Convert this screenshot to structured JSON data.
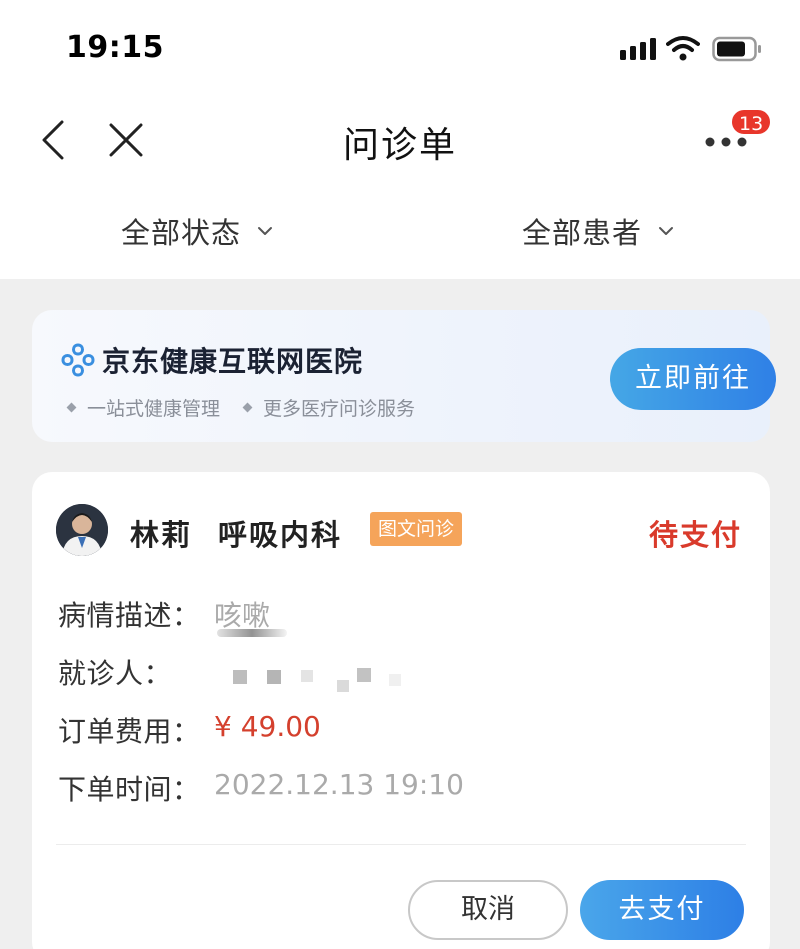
{
  "status_bar": {
    "time": "19:15"
  },
  "nav": {
    "title": "问诊单",
    "badge": "13"
  },
  "filters": {
    "status": "全部状态",
    "patient": "全部患者"
  },
  "banner": {
    "title": "京东健康互联网医院",
    "sub1": "一站式健康管理",
    "sub2": "更多医疗问诊服务",
    "button": "立即前往"
  },
  "order": {
    "doctor_name": "林莉",
    "department": "呼吸内科",
    "tag": "图文问诊",
    "status": "待支付",
    "rows": [
      {
        "label": "病情描述：",
        "value": "咳嗽"
      },
      {
        "label": "就诊人：",
        "value": ""
      },
      {
        "label": "订单费用：",
        "value": "¥ 49.00"
      },
      {
        "label": "下单时间：",
        "value": "2022.12.13 19:10"
      }
    ],
    "cancel_label": "取消",
    "pay_label": "去支付"
  },
  "colors": {
    "accent_blue": "#2f80e6",
    "status_red": "#d93a2b",
    "tag_orange": "#f5a45a"
  }
}
